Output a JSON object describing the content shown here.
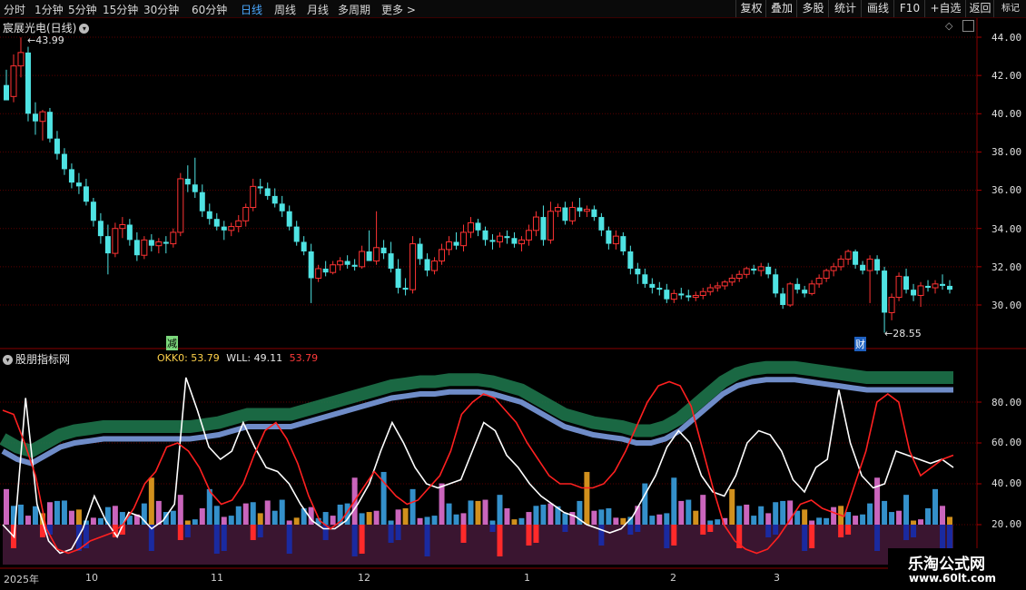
{
  "toolbar": {
    "periods": [
      "分时",
      "1分钟",
      "5分钟",
      "15分钟",
      "30分钟",
      "60分钟",
      "日线",
      "周线",
      "月线",
      "多周期",
      "更多 >"
    ],
    "active_period": "日线",
    "buttons": [
      "复权",
      "叠加",
      "多股",
      "统计",
      "画线",
      "F10",
      "+自选",
      "返回"
    ]
  },
  "main_chart": {
    "title": "宸展光电(日线)",
    "y_ticks": [
      "44.00",
      "42.00",
      "40.00",
      "38.00",
      "36.00",
      "34.00",
      "32.00",
      "30.00"
    ],
    "high_label": "43.99",
    "low_label": "28.55",
    "markers": [
      "减",
      "财"
    ]
  },
  "indicator": {
    "title": "股朋指标网",
    "okk_label": "OKK0: 53.79",
    "wll_label": "WLL: 49.11",
    "third_value": "53.79",
    "y_ticks": [
      "80.00",
      "60.00",
      "40.00",
      "20.00"
    ]
  },
  "x_axis": {
    "labels": [
      "2025年",
      "10",
      "11",
      "12",
      "1",
      "2",
      "3"
    ]
  },
  "watermark": {
    "line1": "乐淘公式网",
    "line2": "www.60lt.com"
  },
  "colors": {
    "up": "#ff3333",
    "down": "#4fe3e3",
    "grid": "#5a0000",
    "okk_label": "#ffd24a",
    "wll_label": "#e6e6e6",
    "third_label": "#ff3a3a"
  },
  "chart_data": [
    {
      "type": "candlestick",
      "title": "宸展光电(日线)",
      "ylim": [
        28,
        44.5
      ],
      "y_ticks": [
        44,
        42,
        40,
        38,
        36,
        34,
        32,
        30
      ],
      "annotations": [
        {
          "text": "43.99",
          "y": 43.99
        },
        {
          "text": "28.55",
          "y": 28.55
        }
      ],
      "ohlc": [
        [
          41.5,
          42.3,
          40.8,
          40.7
        ],
        [
          40.9,
          43.1,
          40.6,
          42.5
        ],
        [
          42.5,
          43.99,
          41.9,
          43.2
        ],
        [
          43.2,
          43.5,
          39.6,
          40.0
        ],
        [
          40.0,
          40.6,
          38.9,
          39.6
        ],
        [
          39.6,
          40.2,
          38.6,
          40.1
        ],
        [
          40.1,
          40.3,
          38.5,
          38.7
        ],
        [
          38.7,
          39.1,
          37.6,
          37.9
        ],
        [
          37.9,
          38.2,
          36.8,
          37.1
        ],
        [
          37.1,
          37.4,
          36.1,
          36.4
        ],
        [
          36.4,
          36.9,
          35.8,
          36.2
        ],
        [
          36.2,
          36.6,
          35.2,
          35.4
        ],
        [
          35.4,
          35.6,
          34.1,
          34.4
        ],
        [
          34.4,
          34.8,
          33.2,
          33.6
        ],
        [
          33.6,
          34.2,
          31.6,
          32.7
        ],
        [
          32.7,
          34.3,
          32.5,
          34.0
        ],
        [
          34.0,
          34.6,
          33.5,
          34.2
        ],
        [
          34.2,
          34.5,
          33.1,
          33.4
        ],
        [
          33.4,
          33.8,
          32.3,
          32.6
        ],
        [
          32.6,
          33.6,
          32.4,
          33.4
        ],
        [
          33.4,
          33.7,
          32.8,
          33.1
        ],
        [
          33.1,
          33.5,
          32.7,
          33.3
        ],
        [
          33.3,
          33.6,
          32.7,
          33.2
        ],
        [
          33.2,
          34.0,
          33.0,
          33.8
        ],
        [
          33.8,
          36.9,
          33.6,
          36.6
        ],
        [
          36.6,
          37.3,
          35.9,
          36.3
        ],
        [
          36.3,
          37.7,
          35.6,
          35.9
        ],
        [
          35.9,
          36.3,
          34.6,
          34.9
        ],
        [
          34.9,
          35.3,
          34.2,
          34.5
        ],
        [
          34.5,
          34.8,
          33.9,
          34.1
        ],
        [
          34.1,
          34.4,
          33.4,
          33.9
        ],
        [
          33.9,
          34.3,
          33.6,
          34.1
        ],
        [
          34.1,
          34.7,
          33.8,
          34.4
        ],
        [
          34.4,
          35.3,
          34.1,
          35.1
        ],
        [
          35.1,
          36.6,
          34.9,
          36.2
        ],
        [
          36.2,
          36.6,
          35.8,
          36.1
        ],
        [
          36.1,
          36.4,
          35.5,
          35.7
        ],
        [
          35.7,
          36.1,
          35.1,
          35.3
        ],
        [
          35.3,
          35.7,
          34.6,
          34.9
        ],
        [
          34.9,
          35.2,
          33.9,
          34.1
        ],
        [
          34.1,
          34.4,
          33.1,
          33.3
        ],
        [
          33.3,
          33.6,
          32.6,
          32.8
        ],
        [
          32.8,
          33.2,
          30.1,
          31.4
        ],
        [
          31.4,
          32.1,
          31.2,
          31.9
        ],
        [
          31.9,
          32.3,
          31.5,
          31.7
        ],
        [
          31.7,
          32.3,
          31.6,
          32.1
        ],
        [
          32.1,
          32.5,
          31.8,
          32.3
        ],
        [
          32.3,
          32.6,
          31.9,
          32.1
        ],
        [
          32.1,
          32.4,
          31.8,
          32.0
        ],
        [
          32.0,
          33.1,
          31.9,
          32.8
        ],
        [
          32.8,
          33.9,
          32.5,
          32.3
        ],
        [
          32.3,
          34.9,
          32.1,
          33.0
        ],
        [
          33.0,
          33.4,
          32.4,
          32.7
        ],
        [
          32.7,
          33.3,
          31.7,
          31.9
        ],
        [
          31.9,
          32.4,
          30.6,
          30.9
        ],
        [
          30.9,
          31.4,
          30.5,
          30.8
        ],
        [
          30.8,
          33.6,
          30.6,
          33.2
        ],
        [
          33.2,
          33.5,
          32.1,
          32.4
        ],
        [
          32.4,
          32.7,
          31.5,
          31.8
        ],
        [
          31.8,
          32.5,
          31.6,
          32.3
        ],
        [
          32.3,
          33.2,
          32.1,
          32.9
        ],
        [
          32.9,
          33.6,
          32.6,
          33.3
        ],
        [
          33.3,
          33.8,
          32.9,
          33.1
        ],
        [
          33.1,
          34.2,
          32.8,
          33.8
        ],
        [
          33.8,
          34.6,
          33.5,
          34.3
        ],
        [
          34.3,
          34.5,
          33.6,
          33.9
        ],
        [
          33.9,
          34.1,
          33.1,
          33.4
        ],
        [
          33.4,
          33.7,
          32.9,
          33.3
        ],
        [
          33.3,
          33.8,
          33.0,
          33.6
        ],
        [
          33.6,
          33.9,
          33.2,
          33.5
        ],
        [
          33.5,
          33.8,
          33.0,
          33.2
        ],
        [
          33.2,
          33.6,
          32.8,
          33.4
        ],
        [
          33.4,
          34.2,
          33.1,
          33.9
        ],
        [
          33.9,
          34.9,
          33.6,
          34.6
        ],
        [
          34.6,
          35.2,
          33.1,
          33.4
        ],
        [
          33.4,
          35.4,
          33.2,
          34.9
        ],
        [
          34.9,
          35.3,
          34.6,
          35.1
        ],
        [
          35.1,
          35.4,
          34.2,
          34.4
        ],
        [
          34.4,
          35.4,
          34.2,
          35.1
        ],
        [
          35.1,
          35.6,
          34.6,
          34.9
        ],
        [
          34.9,
          35.2,
          34.6,
          35.0
        ],
        [
          35.0,
          35.2,
          34.4,
          34.6
        ],
        [
          34.6,
          34.8,
          33.6,
          33.9
        ],
        [
          33.9,
          34.1,
          32.9,
          33.2
        ],
        [
          33.2,
          33.9,
          32.9,
          33.6
        ],
        [
          33.6,
          33.8,
          32.6,
          32.8
        ],
        [
          32.8,
          33.1,
          31.6,
          31.9
        ],
        [
          31.9,
          32.2,
          31.1,
          31.6
        ],
        [
          31.6,
          31.9,
          30.9,
          31.1
        ],
        [
          31.1,
          31.4,
          30.6,
          30.9
        ],
        [
          30.9,
          31.2,
          30.5,
          30.8
        ],
        [
          30.8,
          31.1,
          30.1,
          30.3
        ],
        [
          30.3,
          30.8,
          30.1,
          30.6
        ],
        [
          30.6,
          30.9,
          30.3,
          30.5
        ],
        [
          30.5,
          30.8,
          30.2,
          30.4
        ],
        [
          30.4,
          30.7,
          30.2,
          30.5
        ],
        [
          30.5,
          30.9,
          30.3,
          30.7
        ],
        [
          30.7,
          31.1,
          30.5,
          30.9
        ],
        [
          30.9,
          31.2,
          30.7,
          31.0
        ],
        [
          31.0,
          31.3,
          30.8,
          31.2
        ],
        [
          31.2,
          31.6,
          31.0,
          31.4
        ],
        [
          31.4,
          31.8,
          31.2,
          31.6
        ],
        [
          31.6,
          32.0,
          31.4,
          31.9
        ],
        [
          31.9,
          32.1,
          31.6,
          31.8
        ],
        [
          31.8,
          32.2,
          31.5,
          32.0
        ],
        [
          32.0,
          32.2,
          31.4,
          31.6
        ],
        [
          31.6,
          31.9,
          30.4,
          30.6
        ],
        [
          30.6,
          30.9,
          29.8,
          30.0
        ],
        [
          30.0,
          31.2,
          29.9,
          31.1
        ],
        [
          31.1,
          31.4,
          30.6,
          30.8
        ],
        [
          30.8,
          31.0,
          30.4,
          30.6
        ],
        [
          30.6,
          31.3,
          30.5,
          31.1
        ],
        [
          31.1,
          31.6,
          30.9,
          31.4
        ],
        [
          31.4,
          31.9,
          31.2,
          31.8
        ],
        [
          31.8,
          32.2,
          31.5,
          32.0
        ],
        [
          32.0,
          32.6,
          31.8,
          32.4
        ],
        [
          32.4,
          32.9,
          32.1,
          32.8
        ],
        [
          32.8,
          32.9,
          31.9,
          32.1
        ],
        [
          32.1,
          32.3,
          31.6,
          31.8
        ],
        [
          31.8,
          32.6,
          30.1,
          32.4
        ],
        [
          32.4,
          32.6,
          31.6,
          31.8
        ],
        [
          31.8,
          32.0,
          28.55,
          29.6
        ],
        [
          29.6,
          30.6,
          29.2,
          30.4
        ],
        [
          30.4,
          31.7,
          30.2,
          31.5
        ],
        [
          31.5,
          31.9,
          30.6,
          30.8
        ],
        [
          30.8,
          31.1,
          30.2,
          30.5
        ],
        [
          30.5,
          31.2,
          29.9,
          31.0
        ],
        [
          31.0,
          31.3,
          30.7,
          30.9
        ],
        [
          30.9,
          31.3,
          30.6,
          31.1
        ],
        [
          31.1,
          31.6,
          30.8,
          31.0
        ],
        [
          31.0,
          31.3,
          30.6,
          30.8
        ]
      ]
    },
    {
      "type": "line",
      "title": "股朋指标网",
      "ylim": [
        0,
        100
      ],
      "y_ticks": [
        80,
        60,
        40,
        20
      ],
      "series": [
        {
          "name": "OKK0",
          "color": "#ffffff",
          "values": [
            20,
            14,
            82,
            30,
            12,
            6,
            8,
            18,
            34,
            22,
            14,
            26,
            24,
            18,
            22,
            30,
            92,
            76,
            58,
            52,
            56,
            70,
            58,
            48,
            46,
            40,
            30,
            22,
            18,
            18,
            22,
            30,
            40,
            56,
            70,
            60,
            48,
            40,
            38,
            40,
            42,
            56,
            70,
            66,
            54,
            48,
            40,
            34,
            30,
            26,
            24,
            20,
            18,
            16,
            18,
            24,
            34,
            44,
            58,
            66,
            60,
            44,
            36,
            34,
            44,
            60,
            66,
            64,
            56,
            42,
            36,
            48,
            52,
            86,
            60,
            44,
            38,
            40,
            56,
            54,
            52,
            50,
            52,
            48
          ]
        },
        {
          "name": "WLL",
          "color": "#ff2020",
          "values": [
            76,
            74,
            60,
            44,
            18,
            8,
            6,
            8,
            12,
            14,
            16,
            20,
            28,
            40,
            46,
            58,
            60,
            56,
            48,
            36,
            30,
            32,
            40,
            54,
            66,
            70,
            62,
            50,
            34,
            22,
            18,
            22,
            30,
            38,
            46,
            40,
            34,
            30,
            32,
            38,
            44,
            56,
            74,
            80,
            84,
            82,
            76,
            70,
            60,
            52,
            44,
            40,
            40,
            38,
            38,
            40,
            46,
            56,
            68,
            80,
            88,
            90,
            88,
            78,
            58,
            38,
            20,
            12,
            8,
            6,
            8,
            14,
            22,
            30,
            32,
            28,
            26,
            24,
            40,
            56,
            80,
            84,
            80,
            56,
            44,
            48,
            52,
            54
          ]
        },
        {
          "name": "MA",
          "color": "#6f8cc8",
          "values": [
            56,
            52,
            50,
            54,
            58,
            60,
            61,
            62,
            62,
            62,
            62,
            62,
            62,
            62,
            63,
            64,
            66,
            68,
            68,
            68,
            68,
            70,
            72,
            74,
            76,
            78,
            80,
            82,
            83,
            84,
            84,
            85,
            85,
            85,
            84,
            82,
            80,
            76,
            72,
            68,
            66,
            64,
            63,
            62,
            60,
            60,
            62,
            66,
            72,
            78,
            84,
            88,
            90,
            91,
            91,
            91,
            90,
            89,
            88,
            87,
            86,
            86,
            86,
            86,
            86,
            86,
            86
          ]
        }
      ]
    }
  ]
}
